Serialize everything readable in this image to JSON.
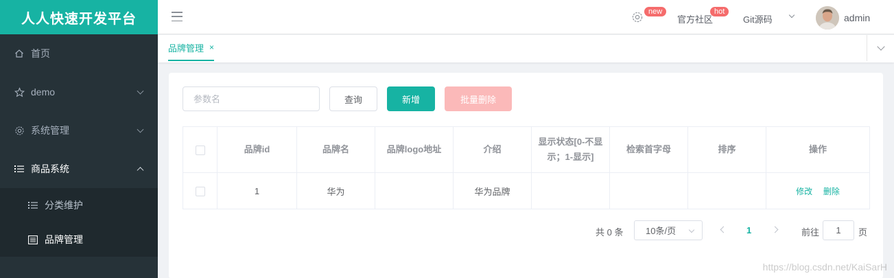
{
  "app": {
    "title": "人人快速开发平台"
  },
  "sidebar": {
    "items": [
      {
        "label": "首页",
        "icon": "home-icon"
      },
      {
        "label": "demo",
        "icon": "star-icon"
      },
      {
        "label": "系统管理",
        "icon": "gear-icon"
      },
      {
        "label": "商品系统",
        "icon": "list-icon",
        "expanded": true
      }
    ],
    "subitems": [
      {
        "label": "分类维护",
        "icon": "list-icon"
      },
      {
        "label": "品牌管理",
        "icon": "table-icon",
        "active": true
      }
    ]
  },
  "header": {
    "new_badge": "new",
    "community": "官方社区",
    "hot_badge": "hot",
    "git": "Git源码",
    "username": "admin"
  },
  "tabs": [
    {
      "label": "品牌管理",
      "close": "×"
    }
  ],
  "toolbar": {
    "search_placeholder": "参数名",
    "query_label": "查询",
    "add_label": "新增",
    "batch_delete_label": "批量删除"
  },
  "table": {
    "columns": [
      "品牌id",
      "品牌名",
      "品牌logo地址",
      "介绍",
      "显示状态[0-不显示；1-显示]",
      "检索首字母",
      "排序",
      "操作"
    ],
    "rows": [
      {
        "id": "1",
        "name": "华为",
        "logo": "",
        "intro": "华为品牌",
        "status": "",
        "initial": "",
        "sort": "",
        "edit": "修改",
        "delete": "删除"
      }
    ]
  },
  "pagination": {
    "total": "共 0 条",
    "page_size": "10条/页",
    "current": "1",
    "goto": "前往",
    "jump_value": "1",
    "page_unit": "页"
  },
  "watermark": "https://blog.csdn.net/KaiSarH",
  "colors": {
    "accent": "#17b3a3",
    "sidebar": "#263238",
    "danger": "#f56c6c"
  }
}
